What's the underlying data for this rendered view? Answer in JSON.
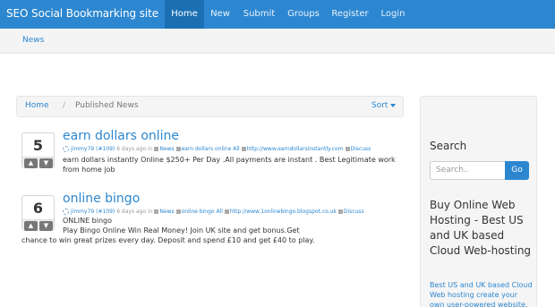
{
  "navbar": {
    "brand": "SEO Social Bookmarking site",
    "items": [
      {
        "label": "Home",
        "active": true
      },
      {
        "label": "New"
      },
      {
        "label": "Submit"
      },
      {
        "label": "Groups"
      },
      {
        "label": "Register"
      },
      {
        "label": "Login"
      }
    ]
  },
  "subnav": {
    "link": "News"
  },
  "breadcrumb": {
    "home": "Home",
    "separator": "/",
    "current": "Published News",
    "sort_label": "Sort"
  },
  "stories": [
    {
      "votes": "5",
      "title": "earn dollars online",
      "meta": {
        "user": "jimmy79 (#109)",
        "time": "6 days ago in",
        "category": "News",
        "tags": "earn dollars online",
        "all": "All",
        "url": "http://www.earndollarsinstantly.com",
        "discuss": "Discuss"
      },
      "description": "earn dollars instantly Online $250+ Per Day .All payments are instant . Best Legitimate work from home job"
    },
    {
      "votes": "6",
      "title": "online bingo",
      "meta": {
        "user": "jimmy79 (#109)",
        "time": "6 days ago in",
        "category": "News",
        "tags": "online bingo",
        "all": "All",
        "url": "http://www.1onlinebingo.blogspot.co.uk",
        "discuss": "Discuss"
      },
      "description_line1": "ONLINE bingo",
      "description_line2": "Play Bingo Online Win Real Money! Join UK site and get bonus.Get",
      "description_line3": "chance to win great prizes every day. Deposit and spend £10 and get £40 to play."
    }
  ],
  "sidebar": {
    "search_title": "Search",
    "search_placeholder": "Search..",
    "search_button": "Go",
    "ad_title": "Buy Online Web Hosting - Best US and UK based Cloud Web-hosting",
    "ad_text": "Best US and UK based Cloud Web hosting create your own user-powered website."
  }
}
